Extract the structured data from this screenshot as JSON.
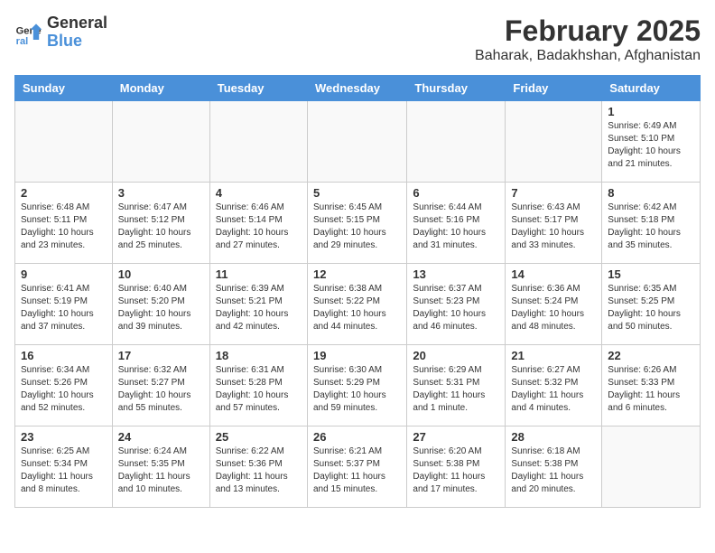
{
  "header": {
    "logo_line1": "General",
    "logo_line2": "Blue",
    "month": "February 2025",
    "location": "Baharak, Badakhshan, Afghanistan"
  },
  "weekdays": [
    "Sunday",
    "Monday",
    "Tuesday",
    "Wednesday",
    "Thursday",
    "Friday",
    "Saturday"
  ],
  "weeks": [
    [
      {
        "day": "",
        "info": ""
      },
      {
        "day": "",
        "info": ""
      },
      {
        "day": "",
        "info": ""
      },
      {
        "day": "",
        "info": ""
      },
      {
        "day": "",
        "info": ""
      },
      {
        "day": "",
        "info": ""
      },
      {
        "day": "1",
        "info": "Sunrise: 6:49 AM\nSunset: 5:10 PM\nDaylight: 10 hours and 21 minutes."
      }
    ],
    [
      {
        "day": "2",
        "info": "Sunrise: 6:48 AM\nSunset: 5:11 PM\nDaylight: 10 hours and 23 minutes."
      },
      {
        "day": "3",
        "info": "Sunrise: 6:47 AM\nSunset: 5:12 PM\nDaylight: 10 hours and 25 minutes."
      },
      {
        "day": "4",
        "info": "Sunrise: 6:46 AM\nSunset: 5:14 PM\nDaylight: 10 hours and 27 minutes."
      },
      {
        "day": "5",
        "info": "Sunrise: 6:45 AM\nSunset: 5:15 PM\nDaylight: 10 hours and 29 minutes."
      },
      {
        "day": "6",
        "info": "Sunrise: 6:44 AM\nSunset: 5:16 PM\nDaylight: 10 hours and 31 minutes."
      },
      {
        "day": "7",
        "info": "Sunrise: 6:43 AM\nSunset: 5:17 PM\nDaylight: 10 hours and 33 minutes."
      },
      {
        "day": "8",
        "info": "Sunrise: 6:42 AM\nSunset: 5:18 PM\nDaylight: 10 hours and 35 minutes."
      }
    ],
    [
      {
        "day": "9",
        "info": "Sunrise: 6:41 AM\nSunset: 5:19 PM\nDaylight: 10 hours and 37 minutes."
      },
      {
        "day": "10",
        "info": "Sunrise: 6:40 AM\nSunset: 5:20 PM\nDaylight: 10 hours and 39 minutes."
      },
      {
        "day": "11",
        "info": "Sunrise: 6:39 AM\nSunset: 5:21 PM\nDaylight: 10 hours and 42 minutes."
      },
      {
        "day": "12",
        "info": "Sunrise: 6:38 AM\nSunset: 5:22 PM\nDaylight: 10 hours and 44 minutes."
      },
      {
        "day": "13",
        "info": "Sunrise: 6:37 AM\nSunset: 5:23 PM\nDaylight: 10 hours and 46 minutes."
      },
      {
        "day": "14",
        "info": "Sunrise: 6:36 AM\nSunset: 5:24 PM\nDaylight: 10 hours and 48 minutes."
      },
      {
        "day": "15",
        "info": "Sunrise: 6:35 AM\nSunset: 5:25 PM\nDaylight: 10 hours and 50 minutes."
      }
    ],
    [
      {
        "day": "16",
        "info": "Sunrise: 6:34 AM\nSunset: 5:26 PM\nDaylight: 10 hours and 52 minutes."
      },
      {
        "day": "17",
        "info": "Sunrise: 6:32 AM\nSunset: 5:27 PM\nDaylight: 10 hours and 55 minutes."
      },
      {
        "day": "18",
        "info": "Sunrise: 6:31 AM\nSunset: 5:28 PM\nDaylight: 10 hours and 57 minutes."
      },
      {
        "day": "19",
        "info": "Sunrise: 6:30 AM\nSunset: 5:29 PM\nDaylight: 10 hours and 59 minutes."
      },
      {
        "day": "20",
        "info": "Sunrise: 6:29 AM\nSunset: 5:31 PM\nDaylight: 11 hours and 1 minute."
      },
      {
        "day": "21",
        "info": "Sunrise: 6:27 AM\nSunset: 5:32 PM\nDaylight: 11 hours and 4 minutes."
      },
      {
        "day": "22",
        "info": "Sunrise: 6:26 AM\nSunset: 5:33 PM\nDaylight: 11 hours and 6 minutes."
      }
    ],
    [
      {
        "day": "23",
        "info": "Sunrise: 6:25 AM\nSunset: 5:34 PM\nDaylight: 11 hours and 8 minutes."
      },
      {
        "day": "24",
        "info": "Sunrise: 6:24 AM\nSunset: 5:35 PM\nDaylight: 11 hours and 10 minutes."
      },
      {
        "day": "25",
        "info": "Sunrise: 6:22 AM\nSunset: 5:36 PM\nDaylight: 11 hours and 13 minutes."
      },
      {
        "day": "26",
        "info": "Sunrise: 6:21 AM\nSunset: 5:37 PM\nDaylight: 11 hours and 15 minutes."
      },
      {
        "day": "27",
        "info": "Sunrise: 6:20 AM\nSunset: 5:38 PM\nDaylight: 11 hours and 17 minutes."
      },
      {
        "day": "28",
        "info": "Sunrise: 6:18 AM\nSunset: 5:38 PM\nDaylight: 11 hours and 20 minutes."
      },
      {
        "day": "",
        "info": ""
      }
    ]
  ]
}
